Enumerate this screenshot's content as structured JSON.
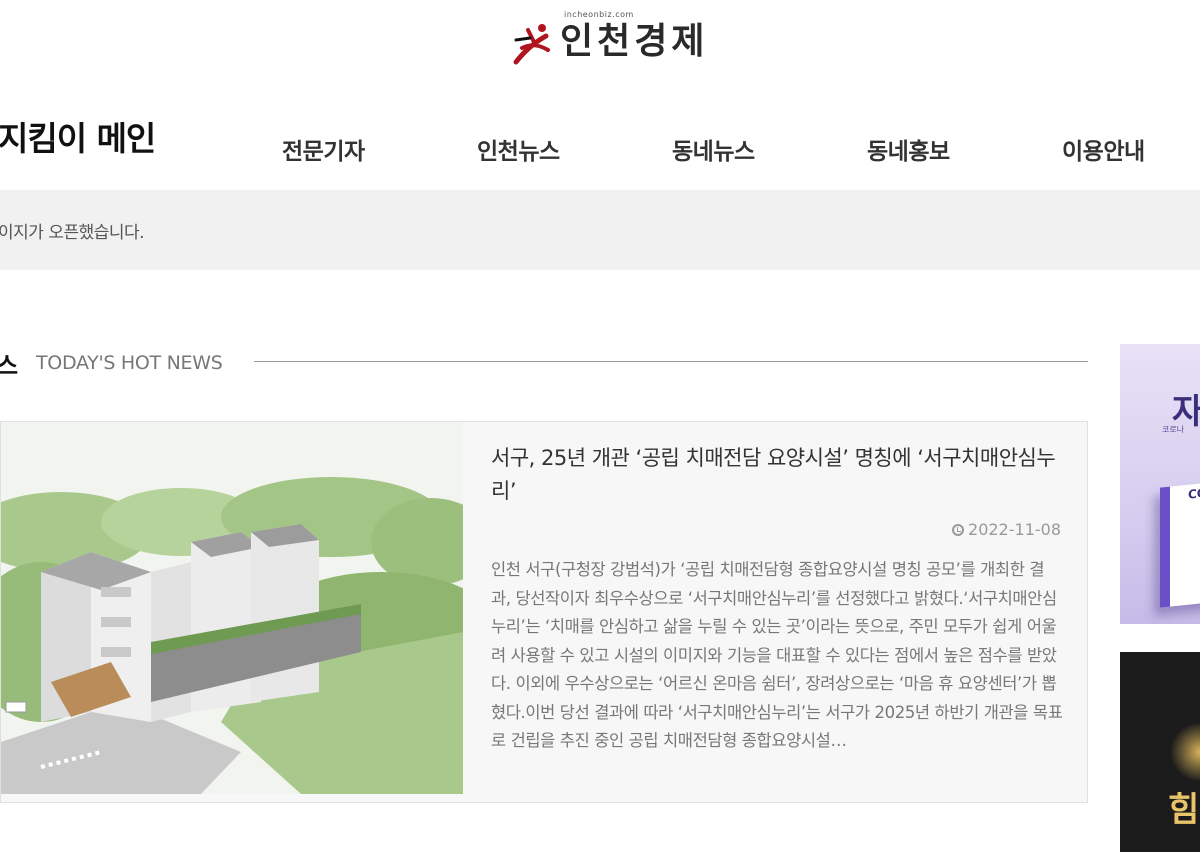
{
  "logo": {
    "domain": "incheonbiz.com",
    "name": "인천경제"
  },
  "site_title": "지킴이 메인",
  "nav": {
    "items": [
      {
        "label": "전문기자"
      },
      {
        "label": "인천뉴스"
      },
      {
        "label": "동네뉴스"
      },
      {
        "label": "동네홍보"
      },
      {
        "label": "이용안내"
      }
    ]
  },
  "notice": {
    "text": "이지가 오픈했습니다."
  },
  "section": {
    "title_ko": "스",
    "title_en": "TODAY'S HOT NEWS"
  },
  "article": {
    "title": "서구, 25년 개관 ‘공립 치매전담 요양시설’ 명칭에 ‘서구치매안심누리’",
    "date": "2022-11-08",
    "summary": "인천 서구(구청장 강범석)가 ‘공립 치매전담형 종합요양시설 명칭 공모’를 개최한 결과, 당선작이자 최우수상으로 ‘서구치매안심누리’를 선정했다고 밝혔다.‘서구치매안심누리’는 ‘치매를 안심하고 삶을 누릴 수 있는 곳’이라는 뜻으로, 주민 모두가 쉽게 어울려 사용할 수 있고 시설의 이미지와 기능을 대표할 수 있다는 점에서 높은 점수를 받았다. 이외에 우수상으로는 ‘어르신 온마음 쉼터’, 장려상으로는 ‘마음 휴 요양센터’가 뽑혔다.이번 당선 결과에 따라 ‘서구치매안심누리’는 서구가 2025년 하반기 개관을 목표로 건립을 추진 중인 공립 치매전담형 종합요양시설…"
  },
  "ads": {
    "ad1": {
      "big": "자",
      "small": "코로나",
      "box": "CO Ho"
    },
    "ad2": {
      "big": "힘"
    }
  },
  "colors": {
    "logo_red": "#b0141e",
    "notice_bg": "#f1f1f1",
    "card_bg": "#f7f7f7"
  }
}
